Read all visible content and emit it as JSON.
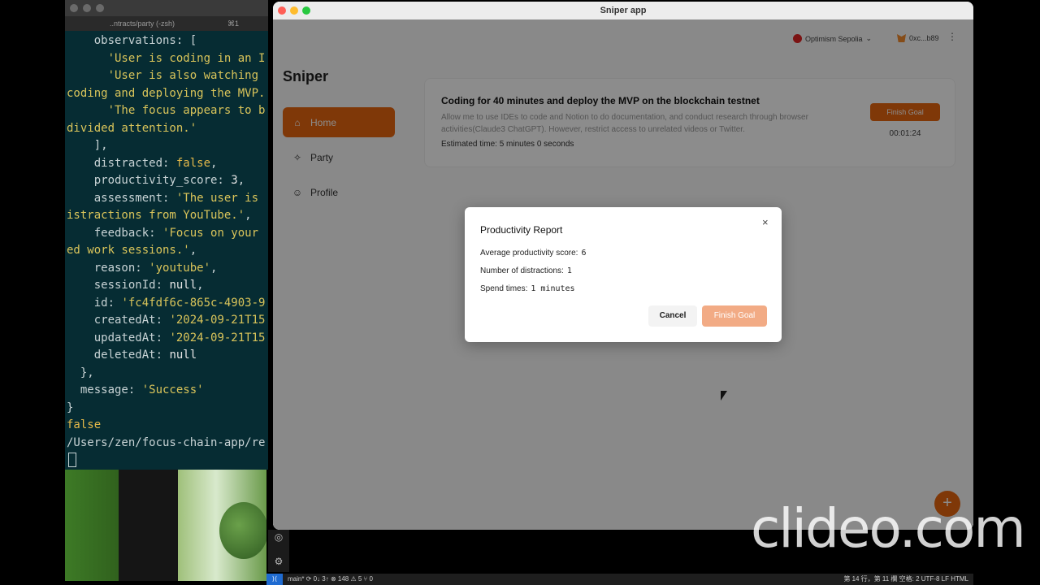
{
  "terminal": {
    "tab_title": "..ntracts/party (-zsh)",
    "tab_key": "⌘1",
    "lines": [
      [
        {
          "t": "    observations: ["
        }
      ],
      [
        {
          "t": "      "
        },
        {
          "t": "'User is coding in an I",
          "c": "s"
        }
      ],
      [
        {
          "t": "      "
        },
        {
          "t": "'User is also watching ",
          "c": "s"
        }
      ],
      [
        {
          "t": "coding and deploying the MVP.",
          "c": "s"
        }
      ],
      [
        {
          "t": "      "
        },
        {
          "t": "'The focus appears to b",
          "c": "s"
        }
      ],
      [
        {
          "t": "divided attention.'",
          "c": "s"
        }
      ],
      [
        {
          "t": "    ],"
        }
      ],
      [
        {
          "t": "    distracted: "
        },
        {
          "t": "false",
          "c": "k"
        },
        {
          "t": ","
        }
      ],
      [
        {
          "t": "    productivity_score: "
        },
        {
          "t": "3",
          "c": "n"
        },
        {
          "t": ","
        }
      ],
      [
        {
          "t": "    assessment: "
        },
        {
          "t": "'The user is ",
          "c": "s"
        }
      ],
      [
        {
          "t": "istractions from YouTube.'",
          "c": "s"
        },
        {
          "t": ","
        }
      ],
      [
        {
          "t": "    feedback: "
        },
        {
          "t": "'Focus on your ",
          "c": "s"
        }
      ],
      [
        {
          "t": "ed work sessions.'",
          "c": "s"
        },
        {
          "t": ","
        }
      ],
      [
        {
          "t": "    reason: "
        },
        {
          "t": "'youtube'",
          "c": "s"
        },
        {
          "t": ","
        }
      ],
      [
        {
          "t": "    sessionId: "
        },
        {
          "t": "null",
          "c": "n"
        },
        {
          "t": ","
        }
      ],
      [
        {
          "t": "    id: "
        },
        {
          "t": "'fc4fdf6c-865c-4903-9",
          "c": "s"
        }
      ],
      [
        {
          "t": "    createdAt: "
        },
        {
          "t": "'2024-09-21T15",
          "c": "s"
        }
      ],
      [
        {
          "t": "    updatedAt: "
        },
        {
          "t": "'2024-09-21T15",
          "c": "s"
        }
      ],
      [
        {
          "t": "    deletedAt: "
        },
        {
          "t": "null",
          "c": "n"
        }
      ],
      [
        {
          "t": "  },"
        }
      ],
      [
        {
          "t": "  message: "
        },
        {
          "t": "'Success'",
          "c": "s"
        }
      ],
      [
        {
          "t": "}"
        }
      ],
      [
        {
          "t": "false",
          "c": "k"
        }
      ],
      [
        {
          "t": "/Users/zen/focus-chain-app/re"
        }
      ]
    ]
  },
  "app": {
    "title": "Sniper app",
    "network": "Optimism Sepolia",
    "account": "0xc...b89",
    "brand": "Sniper",
    "nav": [
      {
        "label": "Home",
        "icon": "⌂",
        "name": "nav-home"
      },
      {
        "label": "Party",
        "icon": "🎉",
        "name": "nav-party"
      },
      {
        "label": "Profile",
        "icon": "👤",
        "name": "nav-profile"
      }
    ],
    "goal": {
      "title": "Coding for 40 minutes and deploy the MVP on the blockchain testnet",
      "description": "Allow me to use IDEs to code and Notion to do documentation, and conduct research through browser activities(Claude3 ChatGPT). However, restrict access to unrelated videos or Twitter.",
      "estimated": "Estimated time: 5 minutes 0 seconds",
      "finish_label": "Finish Goal",
      "timer": "00:01:24"
    },
    "fab": "+"
  },
  "modal": {
    "title": "Productivity Report",
    "close": "×",
    "avg_label": "Average productivity score:",
    "avg_value": "6",
    "distractions_label": "Number of distractions:",
    "distractions_value": "1",
    "spend_label": "Spend times:",
    "spend_value": "1 minutes",
    "cancel_label": "Cancel",
    "finish_label": "Finish Goal"
  },
  "statusbar": {
    "left": "main*  ⟳ 0↓ 3↑   ⊗ 148 ⚠ 5   ⑂ 0",
    "right": "第 14 行，第 11 欄    空格: 2    UTF-8    LF    HTML"
  },
  "watermark": "clideo.com",
  "colors": {
    "accent": "#e8660f",
    "accent_disabled": "#f2ab85",
    "terminal_bg": "#062c33",
    "string": "#d9c45a"
  }
}
